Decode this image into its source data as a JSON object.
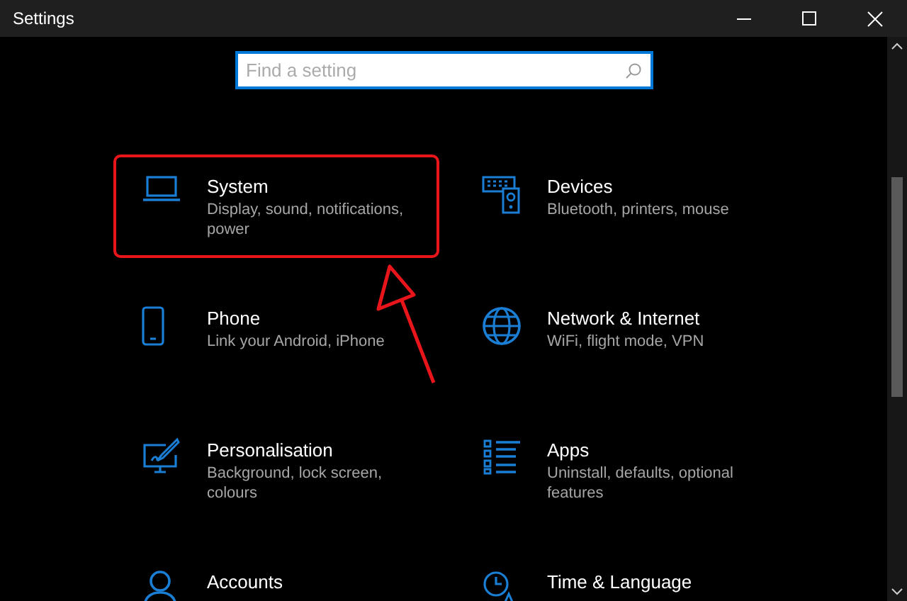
{
  "window": {
    "title": "Settings"
  },
  "search": {
    "placeholder": "Find a setting"
  },
  "tiles": [
    {
      "title": "System",
      "description": "Display, sound, notifications, power",
      "highlighted": true
    },
    {
      "title": "Devices",
      "description": "Bluetooth, printers, mouse",
      "highlighted": false
    },
    {
      "title": "Phone",
      "description": "Link your Android, iPhone",
      "highlighted": false
    },
    {
      "title": "Network & Internet",
      "description": "WiFi, flight mode, VPN",
      "highlighted": false
    },
    {
      "title": "Personalisation",
      "description": "Background, lock screen, colours",
      "highlighted": false
    },
    {
      "title": "Apps",
      "description": "Uninstall, defaults, optional features",
      "highlighted": false
    },
    {
      "title": "Accounts",
      "highlighted": false
    },
    {
      "title": "Time & Language",
      "highlighted": false
    }
  ]
}
